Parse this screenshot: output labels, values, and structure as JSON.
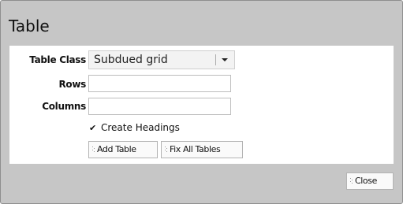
{
  "dialog": {
    "title": "Table"
  },
  "form": {
    "table_class_label": "Table Class",
    "table_class_value": "Subdued grid",
    "rows_label": "Rows",
    "rows_value": "",
    "columns_label": "Columns",
    "columns_value": "",
    "create_headings_label": "Create Headings",
    "create_headings_checked": true,
    "checkbox_glyph": "✔",
    "add_table_label": "Add Table",
    "fix_all_tables_label": "Fix All Tables"
  },
  "footer": {
    "close_label": "Close"
  },
  "icons": {
    "dropdown": "chevron-down-icon",
    "grip": "grip-icon"
  },
  "colors": {
    "dialog_bg": "#c6c6c6",
    "panel_bg": "#ffffff"
  }
}
